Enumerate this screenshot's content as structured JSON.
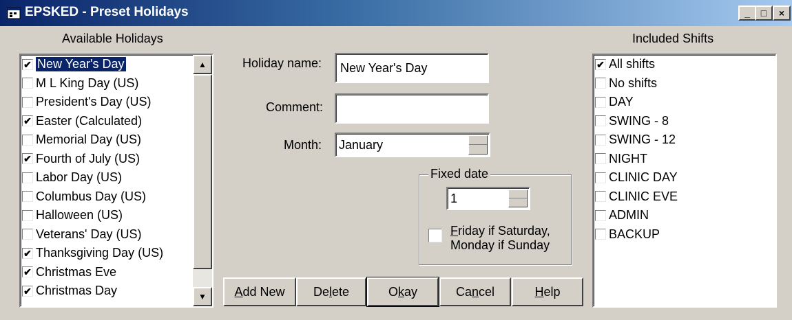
{
  "window": {
    "title": "EPSKED - Preset Holidays",
    "controls": {
      "minimize": "_",
      "maximize": "□",
      "close": "×"
    }
  },
  "holidays": {
    "heading": "Available Holidays",
    "items": [
      {
        "label": "New Year's Day",
        "checked": true,
        "selected": true
      },
      {
        "label": "M L King Day (US)",
        "checked": false
      },
      {
        "label": "President's Day (US)",
        "checked": false
      },
      {
        "label": "Easter (Calculated)",
        "checked": true
      },
      {
        "label": "Memorial Day (US)",
        "checked": false
      },
      {
        "label": "Fourth of July (US)",
        "checked": true
      },
      {
        "label": "Labor  Day (US)",
        "checked": false
      },
      {
        "label": "Columbus Day (US)",
        "checked": false
      },
      {
        "label": "Halloween (US)",
        "checked": false
      },
      {
        "label": "Veterans' Day (US)",
        "checked": false
      },
      {
        "label": "Thanksgiving Day (US)",
        "checked": true
      },
      {
        "label": "Christmas Eve",
        "checked": true
      },
      {
        "label": "Christmas Day",
        "checked": true
      }
    ]
  },
  "form": {
    "holiday_name_label": "Holiday name:",
    "holiday_name_value": "New Year's Day",
    "comment_label": "Comment:",
    "comment_value": "",
    "month_label": "Month:",
    "month_value": "January",
    "fixed_date": {
      "legend": "Fixed date",
      "day_value": "1",
      "weekend_rule_line1_key": "F",
      "weekend_rule_line1_rest": "riday if Saturday,",
      "weekend_rule_line2": "Monday if Sunday",
      "weekend_rule_checked": false
    }
  },
  "buttons": {
    "add_new": {
      "key": "A",
      "rest": "dd New"
    },
    "delete": {
      "pre": "De",
      "key": "l",
      "rest": "ete"
    },
    "okay": {
      "pre": "O",
      "key": "k",
      "rest": "ay"
    },
    "cancel": {
      "pre": "Ca",
      "key": "n",
      "rest": "cel"
    },
    "help": {
      "key": "H",
      "rest": "elp"
    }
  },
  "shifts": {
    "heading": "Included Shifts",
    "items": [
      {
        "label": "All shifts",
        "checked": true
      },
      {
        "label": "No shifts",
        "checked": false
      },
      {
        "label": "DAY",
        "checked": false
      },
      {
        "label": "SWING - 8",
        "checked": false
      },
      {
        "label": "SWING - 12",
        "checked": false
      },
      {
        "label": "NIGHT",
        "checked": false
      },
      {
        "label": "CLINIC DAY",
        "checked": false
      },
      {
        "label": "CLINIC EVE",
        "checked": false
      },
      {
        "label": "ADMIN",
        "checked": false
      },
      {
        "label": "BACKUP",
        "checked": false
      }
    ]
  },
  "glyphs": {
    "check": "✔",
    "scroll_up": "▲",
    "scroll_down": "▼"
  }
}
